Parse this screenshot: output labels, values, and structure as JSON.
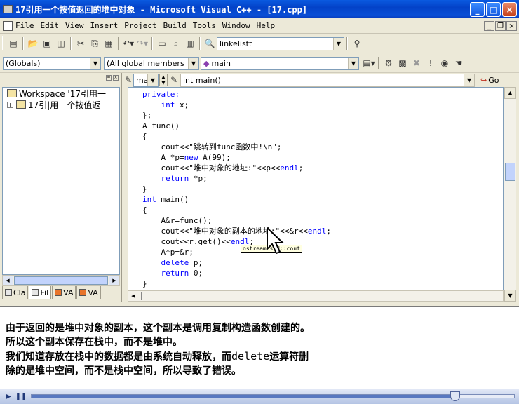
{
  "window": {
    "title": "17引用一个按值返回的堆中对象 - Microsoft Visual C++ - [17.cpp]",
    "minimize": "_",
    "maximize": "□",
    "close": "×"
  },
  "menu": {
    "items": [
      "File",
      "Edit",
      "View",
      "Insert",
      "Project",
      "Build",
      "Tools",
      "Window",
      "Help"
    ],
    "mdi_min": "_",
    "mdi_restore": "❐",
    "mdi_close": "×"
  },
  "toolbar1": {
    "find_combo": "linkelistt"
  },
  "toolbar2": {
    "globals_combo": "(Globals)",
    "members_combo": "(All global members",
    "function_combo": "main"
  },
  "editor_bar": {
    "small_combo": "mai",
    "context_combo": "int main()",
    "go_button": "Go"
  },
  "workspace": {
    "root": "Workspace '17引用一",
    "project": "17引|用一个按值返",
    "tabs": [
      "Cla",
      "Fil",
      "VA",
      "VA"
    ]
  },
  "code": {
    "lines": [
      {
        "indent": "",
        "parts": [
          {
            "t": "private:",
            "c": "kw"
          }
        ]
      },
      {
        "indent": "    ",
        "parts": [
          {
            "t": "int",
            "c": "kw"
          },
          {
            "t": " x;",
            "c": ""
          }
        ]
      },
      {
        "indent": "",
        "parts": [
          {
            "t": "};",
            "c": ""
          }
        ]
      },
      {
        "indent": "",
        "parts": [
          {
            "t": "A func()",
            "c": ""
          }
        ]
      },
      {
        "indent": "",
        "parts": [
          {
            "t": "{",
            "c": ""
          }
        ]
      },
      {
        "indent": "    ",
        "parts": [
          {
            "t": "cout<<\"跳转到func函数中!\\n\";",
            "c": ""
          }
        ]
      },
      {
        "indent": "    ",
        "parts": [
          {
            "t": "A *p=",
            "c": ""
          },
          {
            "t": "new",
            "c": "kw"
          },
          {
            "t": " A(99);",
            "c": ""
          }
        ]
      },
      {
        "indent": "    ",
        "parts": [
          {
            "t": "cout<<\"堆中对象的地址:\"<<p<<",
            "c": ""
          },
          {
            "t": "endl",
            "c": "tp"
          },
          {
            "t": ";",
            "c": ""
          }
        ]
      },
      {
        "indent": "    ",
        "parts": [
          {
            "t": "return",
            "c": "kw"
          },
          {
            "t": " *p;",
            "c": ""
          }
        ]
      },
      {
        "indent": "",
        "parts": [
          {
            "t": "}",
            "c": ""
          }
        ]
      },
      {
        "indent": "",
        "parts": [
          {
            "t": "int",
            "c": "kw"
          },
          {
            "t": " main()",
            "c": ""
          }
        ]
      },
      {
        "indent": "",
        "parts": [
          {
            "t": "{",
            "c": ""
          }
        ]
      },
      {
        "indent": "    ",
        "parts": [
          {
            "t": "A&r=func();",
            "c": ""
          }
        ]
      },
      {
        "indent": "    ",
        "parts": [
          {
            "t": "cout<<\"堆中对象的副本的地址:\"<<&r<<",
            "c": ""
          },
          {
            "t": "endl",
            "c": "tp"
          },
          {
            "t": ";",
            "c": ""
          }
        ]
      },
      {
        "indent": "    ",
        "parts": [
          {
            "t": "cout<<r.get()<<",
            "c": ""
          },
          {
            "t": "endl",
            "c": "tp"
          },
          {
            "t": ";",
            "c": ""
          }
        ]
      },
      {
        "indent": "    ",
        "parts": [
          {
            "t": "A*p=&r;",
            "c": ""
          }
        ]
      },
      {
        "indent": "    ",
        "parts": [
          {
            "t": "delete",
            "c": "kw"
          },
          {
            "t": " p;",
            "c": ""
          }
        ]
      },
      {
        "indent": "    ",
        "parts": [
          {
            "t": "return",
            "c": "kw"
          },
          {
            "t": " 0;",
            "c": ""
          }
        ]
      },
      {
        "indent": "",
        "parts": [
          {
            "t": "}",
            "c": ""
          }
        ]
      }
    ],
    "tooltip": "ostream std::cout"
  },
  "caption": {
    "line1": "由于返回的是堆中对象的副本，这个副本是调用复制构造函数创建的。",
    "line2": "所以这个副本保存在栈中，而不是堆中。",
    "line3_a": "我们知道存放在栈中的数据都是由系统自动释放，而",
    "line3_b": "delete",
    "line3_c": "运算符删",
    "line4": "除的是堆中空间，而不是栈中空间，所以导致了错误。"
  },
  "player": {
    "progress": 0.878,
    "play_icon": "play-icon",
    "pause_icon": "pause-icon"
  },
  "colors": {
    "titlebar": "#0a4fd6",
    "keyword": "#0000ff",
    "tooltip_bg": "#ffffe1"
  }
}
